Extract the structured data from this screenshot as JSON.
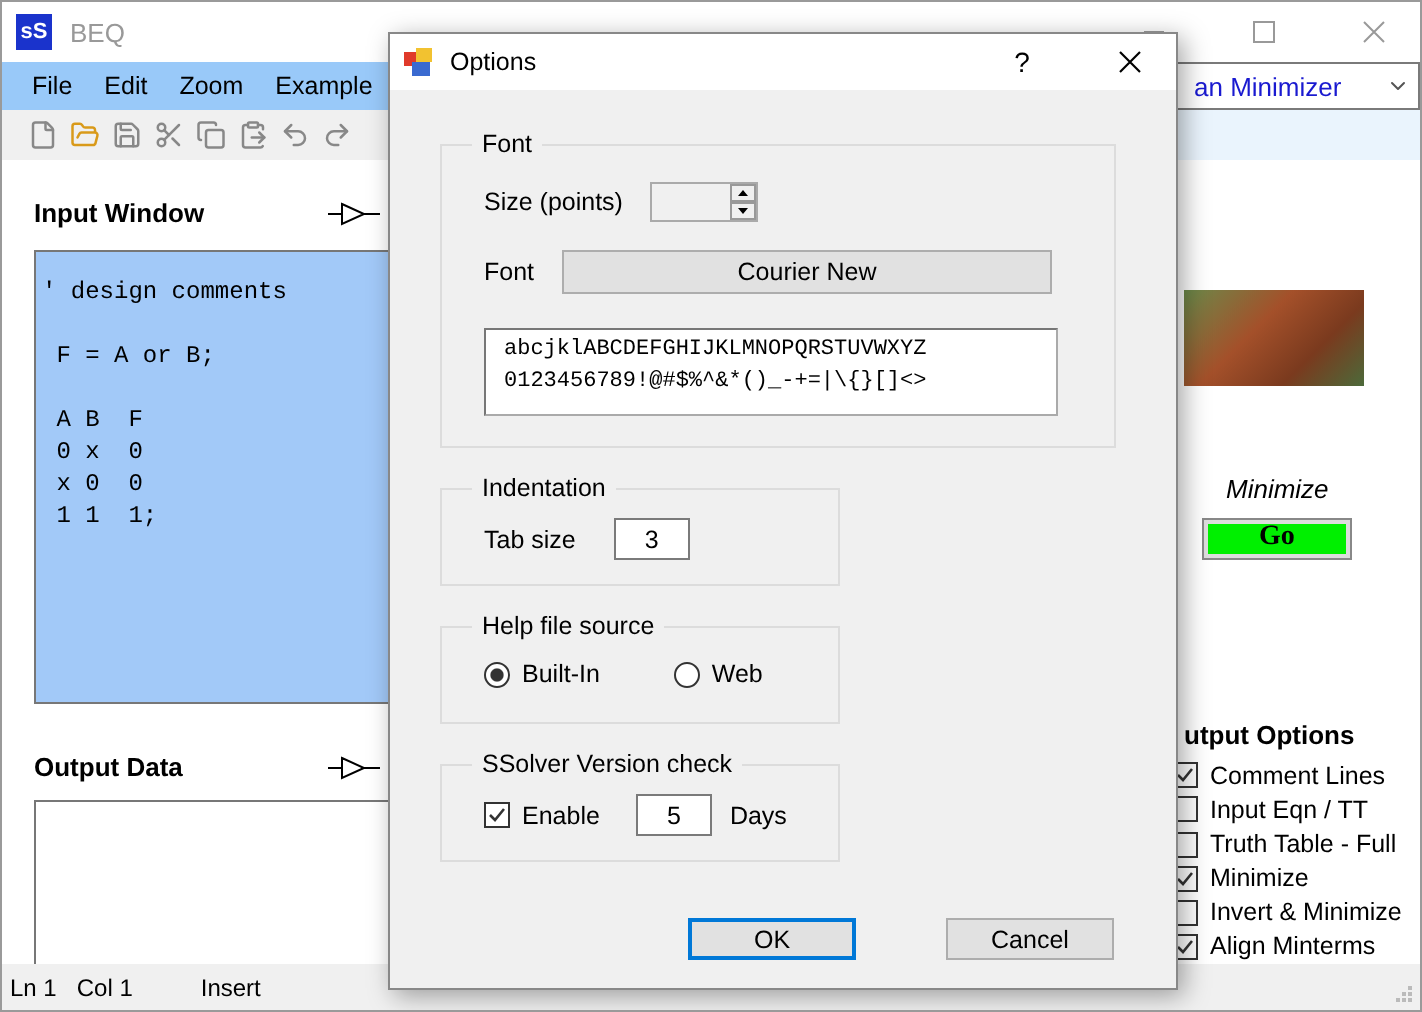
{
  "window": {
    "title": "BEQ",
    "app_icon": "sS"
  },
  "menu": [
    "File",
    "Edit",
    "Zoom",
    "Example"
  ],
  "mode_combo": {
    "value": "an Minimizer"
  },
  "input_window": {
    "title": "Input Window",
    "blocks": [
      [
        "' design comments"
      ],
      [
        " F = A or B;"
      ],
      [
        " A B  F",
        " 0 x  0",
        " x 0  0",
        " 1 1  1;"
      ]
    ]
  },
  "output_data": {
    "title": "Output Data"
  },
  "minimize": {
    "label": "Minimize",
    "button": "Go"
  },
  "output_options": {
    "title": "utput Options",
    "items": [
      {
        "label": "Comment Lines",
        "checked": true
      },
      {
        "label": "Input Eqn / TT",
        "checked": false
      },
      {
        "label": "Truth Table - Full",
        "checked": false
      },
      {
        "label": "Minimize",
        "checked": true
      },
      {
        "label": "Invert & Minimize",
        "checked": false
      },
      {
        "label": "Align Minterms",
        "checked": true
      }
    ]
  },
  "status_bar": [
    "Ln 1",
    "Col 1",
    "Insert"
  ],
  "dialog": {
    "title": "Options",
    "help": "?",
    "font_group": {
      "title": "Font",
      "size_label": "Size (points)",
      "font_label": "Font",
      "font_button": "Courier New",
      "preview": [
        "abcjklABCDEFGHIJKLMNOPQRSTUVWXYZ",
        "0123456789!@#$%^&*()_-+=|\\{}[]<>"
      ]
    },
    "indentation": {
      "title": "Indentation",
      "tab_label": "Tab size",
      "tab_value": "3"
    },
    "help_source": {
      "title": "Help file source",
      "options": [
        {
          "label": "Built-In",
          "selected": true
        },
        {
          "label": "Web",
          "selected": false
        }
      ]
    },
    "version_check": {
      "title": "SSolver Version check",
      "enable": {
        "label": "Enable",
        "checked": true
      },
      "days_value": "5",
      "days_label": "Days"
    },
    "buttons": [
      {
        "label": "OK",
        "default": true
      },
      {
        "label": "Cancel",
        "default": false
      }
    ]
  }
}
